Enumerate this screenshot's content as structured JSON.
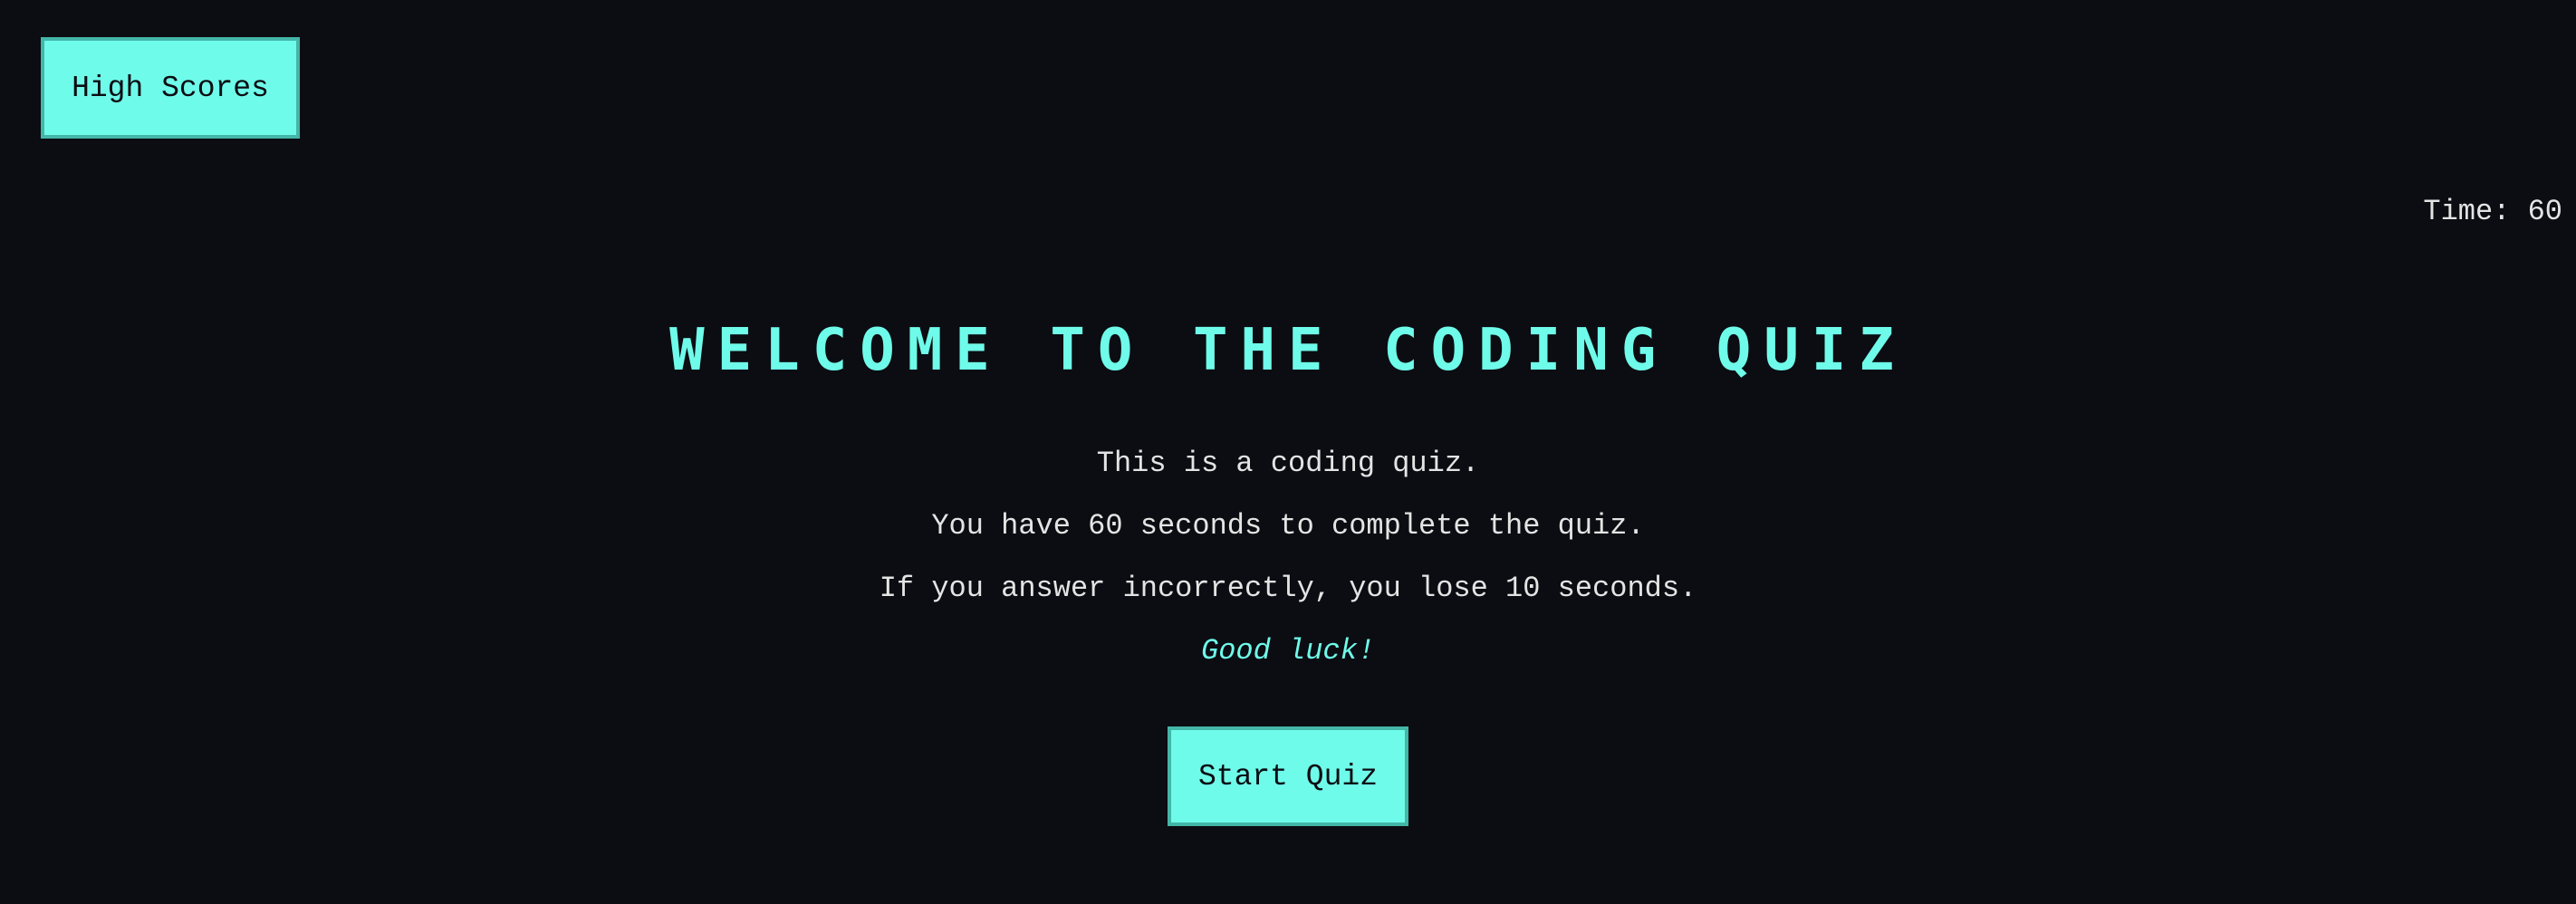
{
  "header": {
    "high_scores_label": "High Scores",
    "timer_text": "Time: 60"
  },
  "main": {
    "title": "WELCOME TO THE CODING QUIZ",
    "lines": [
      "This is a coding quiz.",
      "You have 60 seconds to complete the quiz.",
      "If you answer incorrectly, you lose 10 seconds."
    ],
    "good_luck": "Good luck!",
    "start_label": "Start Quiz"
  },
  "colors": {
    "background": "#0b0d12",
    "accent": "#6ffbea",
    "text": "#e4e4e4"
  }
}
